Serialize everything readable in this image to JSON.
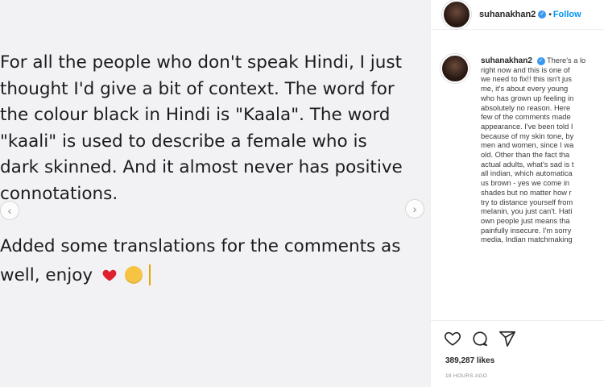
{
  "media": {
    "lines": [
      "For all the people who don't speak Hindi, I just",
      "thought I'd give a bit of context. The word for",
      "the colour black in Hindi is \"Kaala\". The word",
      "\"kaali\" is used to describe a female who is",
      "dark skinned. And it almost never has positive",
      "connotations.",
      "Added some translations for the comments as",
      "well, enjoy"
    ],
    "emoji": [
      "red-heart",
      "grinning-sweat-face"
    ]
  },
  "header": {
    "username": "suhanakhan2",
    "separator": "•",
    "follow_label": "Follow"
  },
  "caption": {
    "username": "suhanakhan2",
    "lines": [
      "There's a lo",
      "right now and this is one of",
      "we need to fix!! this isn't jus",
      "me, it's about every young",
      "who has grown up feeling in",
      "absolutely no reason. Here",
      "few of the comments made",
      "appearance. I've been told I",
      "because of my skin tone, by",
      "men and women, since I wa",
      "old. Other than the fact tha",
      "actual adults, what's sad is t",
      "all indian, which automatica",
      "us brown - yes we come in",
      "shades but no matter how r",
      "try to distance yourself from",
      "melanin, you just can't. Hati",
      "own people just means tha",
      "painfully insecure. I'm sorry",
      "media, Indian matchmaking"
    ]
  },
  "stats": {
    "likes": "389,287 likes",
    "time": "18 HOURS AGO"
  },
  "colors": {
    "accent": "#0095f6",
    "verified": "#3897f0",
    "media_bg": "#f2f2f4",
    "heart_emoji": "#e0202f",
    "face_emoji": "#f6c343"
  },
  "icons": [
    "chevron-left-icon",
    "chevron-right-icon",
    "heart-icon",
    "comment-icon",
    "share-icon",
    "verified-icon"
  ]
}
